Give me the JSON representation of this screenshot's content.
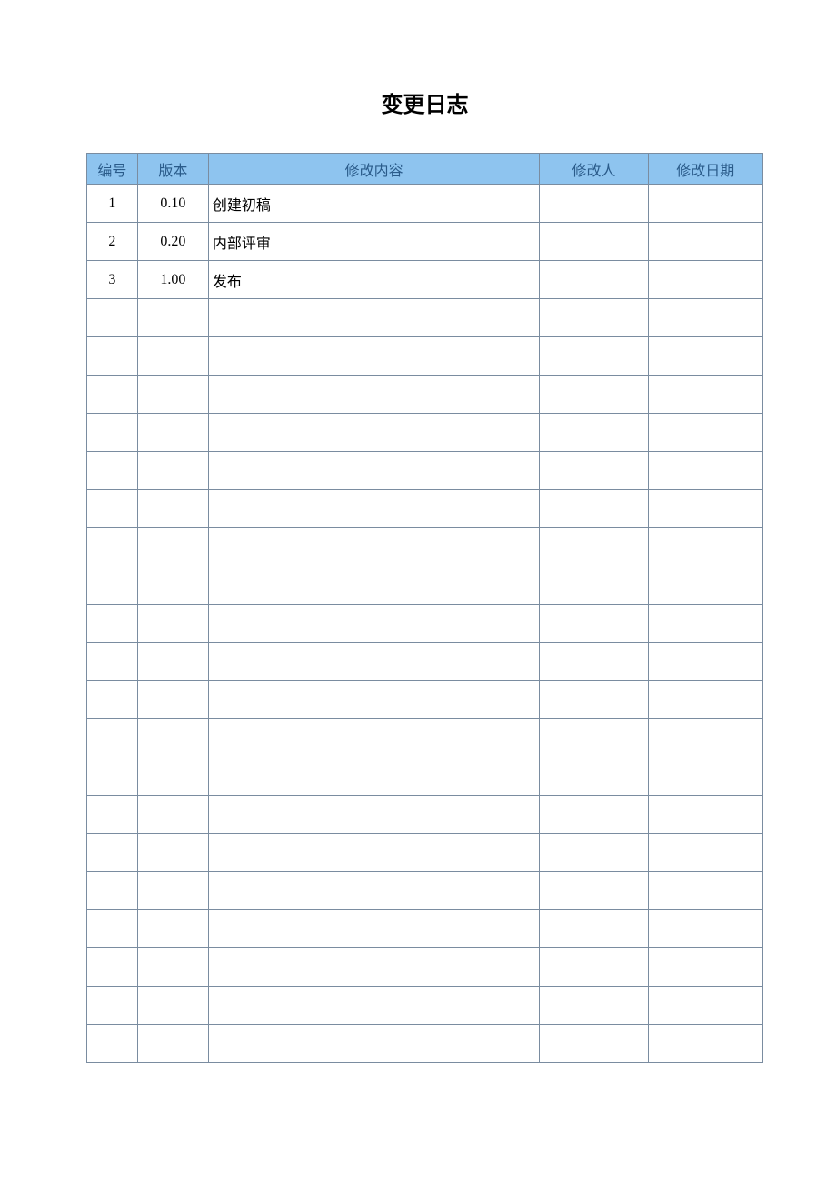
{
  "title": "变更日志",
  "headers": {
    "no": "编号",
    "version": "版本",
    "content": "修改内容",
    "modifier": "修改人",
    "date": "修改日期"
  },
  "rows": [
    {
      "no": "1",
      "version": "0.10",
      "content": "创建初稿",
      "modifier": "",
      "date": ""
    },
    {
      "no": "2",
      "version": "0.20",
      "content": "内部评审",
      "modifier": "",
      "date": ""
    },
    {
      "no": "3",
      "version": "1.00",
      "content": "发布",
      "modifier": "",
      "date": ""
    },
    {
      "no": "",
      "version": "",
      "content": "",
      "modifier": "",
      "date": ""
    },
    {
      "no": "",
      "version": "",
      "content": "",
      "modifier": "",
      "date": ""
    },
    {
      "no": "",
      "version": "",
      "content": "",
      "modifier": "",
      "date": ""
    },
    {
      "no": "",
      "version": "",
      "content": "",
      "modifier": "",
      "date": ""
    },
    {
      "no": "",
      "version": "",
      "content": "",
      "modifier": "",
      "date": ""
    },
    {
      "no": "",
      "version": "",
      "content": "",
      "modifier": "",
      "date": ""
    },
    {
      "no": "",
      "version": "",
      "content": "",
      "modifier": "",
      "date": ""
    },
    {
      "no": "",
      "version": "",
      "content": "",
      "modifier": "",
      "date": ""
    },
    {
      "no": "",
      "version": "",
      "content": "",
      "modifier": "",
      "date": ""
    },
    {
      "no": "",
      "version": "",
      "content": "",
      "modifier": "",
      "date": ""
    },
    {
      "no": "",
      "version": "",
      "content": "",
      "modifier": "",
      "date": ""
    },
    {
      "no": "",
      "version": "",
      "content": "",
      "modifier": "",
      "date": ""
    },
    {
      "no": "",
      "version": "",
      "content": "",
      "modifier": "",
      "date": ""
    },
    {
      "no": "",
      "version": "",
      "content": "",
      "modifier": "",
      "date": ""
    },
    {
      "no": "",
      "version": "",
      "content": "",
      "modifier": "",
      "date": ""
    },
    {
      "no": "",
      "version": "",
      "content": "",
      "modifier": "",
      "date": ""
    },
    {
      "no": "",
      "version": "",
      "content": "",
      "modifier": "",
      "date": ""
    },
    {
      "no": "",
      "version": "",
      "content": "",
      "modifier": "",
      "date": ""
    },
    {
      "no": "",
      "version": "",
      "content": "",
      "modifier": "",
      "date": ""
    },
    {
      "no": "",
      "version": "",
      "content": "",
      "modifier": "",
      "date": ""
    }
  ]
}
